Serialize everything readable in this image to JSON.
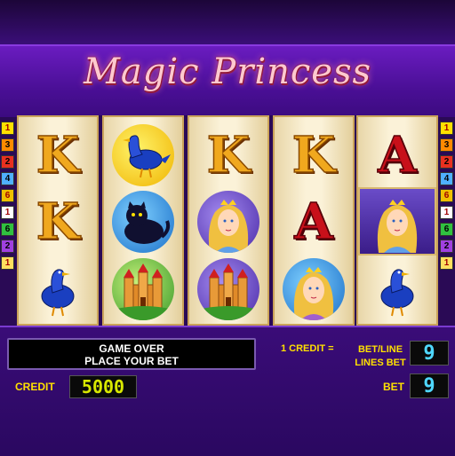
{
  "game": {
    "title": "Magic Princess"
  },
  "reels": [
    [
      "K",
      "K",
      "bird"
    ],
    [
      "bird",
      "panther",
      "castle"
    ],
    [
      "K",
      "princess",
      "castle"
    ],
    [
      "K",
      "A",
      "princess"
    ],
    [
      "A",
      "princess",
      "bird"
    ]
  ],
  "left_lines": [
    "1",
    "3",
    "2",
    "4",
    "6",
    "1",
    "6",
    "2",
    "1"
  ],
  "left_line_colors": [
    "#ffe000",
    "#ff8a00",
    "#e83020",
    "#4fb0ff",
    "#f0c000",
    "#ffffff",
    "#30c040",
    "#a040e0",
    "#ffe060"
  ],
  "right_lines": [
    "1",
    "3",
    "2",
    "4",
    "6",
    "1",
    "6",
    "2",
    "1"
  ],
  "right_line_colors": [
    "#ffe000",
    "#ff8a00",
    "#e83020",
    "#4fb0ff",
    "#f0c000",
    "#ffffff",
    "#30c040",
    "#a040e0",
    "#ffe060"
  ],
  "message": {
    "line1": "GAME OVER",
    "line2": "PLACE YOUR BET"
  },
  "credit": {
    "label": "CREDIT",
    "value": "5000",
    "rate": "1 CREDIT ="
  },
  "bet": {
    "betline_label": "BET/LINE",
    "lines_bet_label": "LINES BET",
    "lines_value": "9",
    "bet_label": "BET",
    "bet_value": "9"
  },
  "colors": {
    "accent": "#6a1cc0",
    "lcd_yellow": "#d8e800",
    "lcd_blue": "#4fd8ff"
  }
}
